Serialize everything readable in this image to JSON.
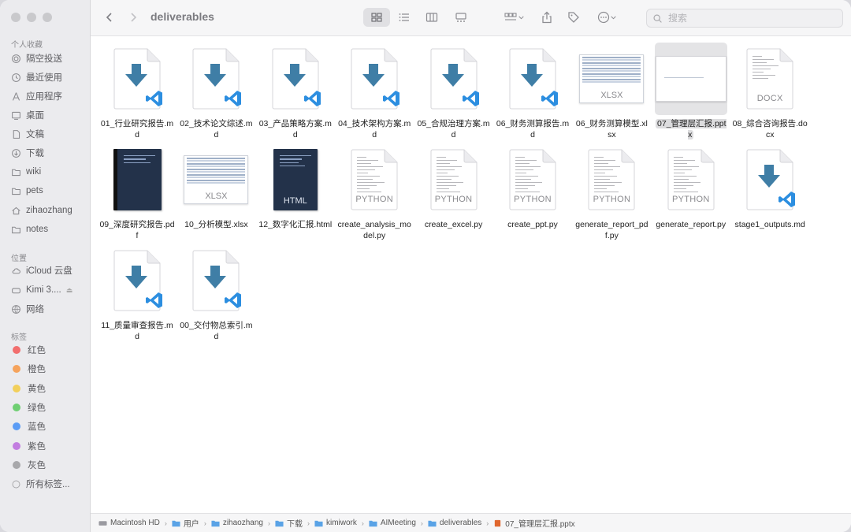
{
  "toolbar": {
    "title": "deliverables",
    "search_placeholder": "搜索"
  },
  "sidebar": {
    "favorites_header": "个人收藏",
    "favorites": [
      "隔空投送",
      "最近使用",
      "应用程序",
      "桌面",
      "文稿",
      "下载",
      "wiki",
      "pets",
      "zihaozhang",
      "notes"
    ],
    "locations_header": "位置",
    "locations": [
      "iCloud 云盘",
      "Kimi 3....",
      "网络"
    ],
    "tags_header": "标签",
    "tags": [
      {
        "label": "红色",
        "color": "#f26e6e"
      },
      {
        "label": "橙色",
        "color": "#f5a35c"
      },
      {
        "label": "黄色",
        "color": "#f2cf5b"
      },
      {
        "label": "绿色",
        "color": "#6fcf72"
      },
      {
        "label": "蓝色",
        "color": "#5b9cf5"
      },
      {
        "label": "紫色",
        "color": "#c27de0"
      },
      {
        "label": "灰色",
        "color": "#a8a8ab"
      },
      {
        "label": "所有标签..."
      }
    ]
  },
  "files": [
    {
      "name": "01_行业研究报告.md",
      "kind": "md"
    },
    {
      "name": "02_技术论文综述.md",
      "kind": "md"
    },
    {
      "name": "03_产品策略方案.md",
      "kind": "md"
    },
    {
      "name": "04_技术架构方案.md",
      "kind": "md"
    },
    {
      "name": "05_合规治理方案.md",
      "kind": "md"
    },
    {
      "name": "06_财务测算报告.md",
      "kind": "md"
    },
    {
      "name": "06_财务测算模型.xlsx",
      "kind": "xlsx",
      "badge": "XLSX"
    },
    {
      "name": "07_管理层汇报.pptx",
      "kind": "pptx",
      "selected": true
    },
    {
      "name": "08_综合咨询报告.docx",
      "kind": "docx",
      "badge": "DOCX"
    },
    {
      "name": "09_深度研究报告.pdf",
      "kind": "pdf"
    },
    {
      "name": "10_分析模型.xlsx",
      "kind": "xlsx",
      "badge": "XLSX"
    },
    {
      "name": "12_数字化汇报.html",
      "kind": "html",
      "badge": "HTML"
    },
    {
      "name": "create_analysis_model.py",
      "kind": "py",
      "badge": "PYTHON"
    },
    {
      "name": "create_excel.py",
      "kind": "py",
      "badge": "PYTHON"
    },
    {
      "name": "create_ppt.py",
      "kind": "py",
      "badge": "PYTHON"
    },
    {
      "name": "generate_report_pdf.py",
      "kind": "py",
      "badge": "PYTHON"
    },
    {
      "name": "generate_report.py",
      "kind": "py",
      "badge": "PYTHON"
    },
    {
      "name": "stage1_outputs.md",
      "kind": "md"
    },
    {
      "name": "11_质量审查报告.md",
      "kind": "md"
    },
    {
      "name": "00_交付物总索引.md",
      "kind": "md"
    }
  ],
  "pathbar": [
    "Macintosh HD",
    "用户",
    "zihaozhang",
    "下载",
    "kimiwork",
    "AIMeeting",
    "deliverables",
    "07_管理层汇报.pptx"
  ],
  "colors": {
    "accent": "#3f7ea6",
    "vscode": "#2c8ee0"
  }
}
